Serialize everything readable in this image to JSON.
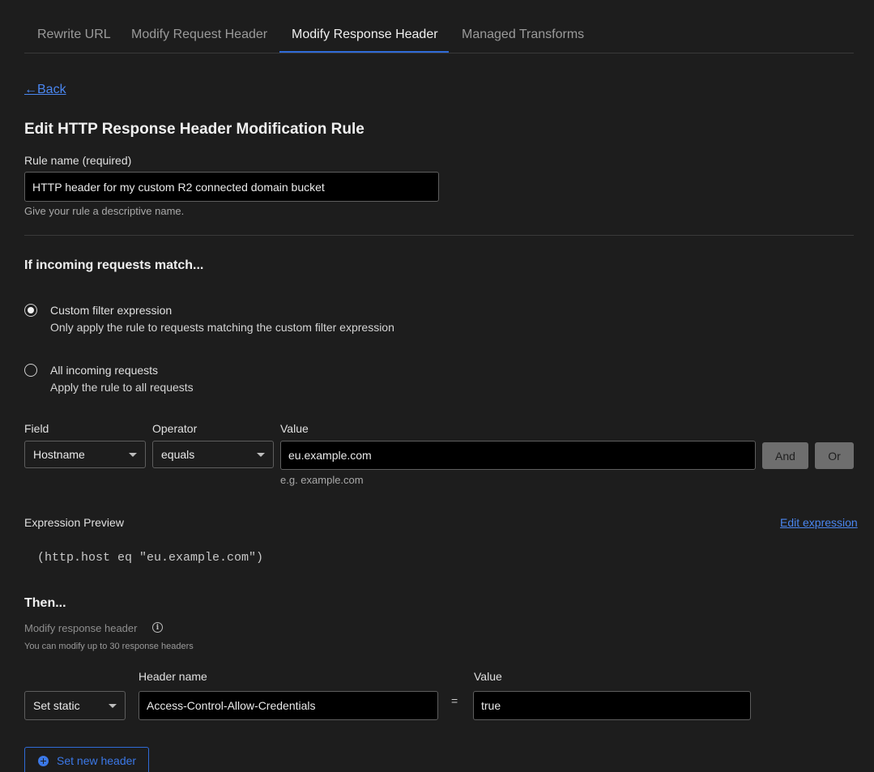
{
  "tabs": [
    {
      "label": "Rewrite URL"
    },
    {
      "label": "Modify Request Header"
    },
    {
      "label": "Modify Response Header"
    },
    {
      "label": "Managed Transforms"
    }
  ],
  "active_tab": "Modify Response Header",
  "back_link": {
    "arrow": "←",
    "label": "Back"
  },
  "page_title": "Edit HTTP Response Header Modification Rule",
  "rule_name": {
    "label": "Rule name (required)",
    "value": "HTTP header for my custom R2 connected domain bucket",
    "help": "Give your rule a descriptive name."
  },
  "match": {
    "heading": "If incoming requests match...",
    "options": [
      {
        "title": "Custom filter expression",
        "description": "Only apply the rule to requests matching the custom filter expression",
        "selected": true
      },
      {
        "title": "All incoming requests",
        "description": "Apply the rule to all requests",
        "selected": false
      }
    ]
  },
  "filter": {
    "field_label": "Field",
    "operator_label": "Operator",
    "value_label": "Value",
    "field_value": "Hostname",
    "operator_value": "equals",
    "value_value": "eu.example.com",
    "value_hint": "e.g. example.com",
    "and_label": "And",
    "or_label": "Or"
  },
  "expression": {
    "label": "Expression Preview",
    "edit_link": "Edit expression",
    "code": "(http.host eq \"eu.example.com\")"
  },
  "then": {
    "heading": "Then...",
    "subheading": "Modify response header",
    "info_icon": "info-icon",
    "limit_hint": "You can modify up to 30 response headers",
    "header_name_label": "Header name",
    "value_label": "Value",
    "action_value": "Set static",
    "header_name_value": "Access-Control-Allow-Credentials",
    "equals_sign": "=",
    "header_value": "true",
    "add_button": "Set new header"
  },
  "colors": {
    "background": "#1d1d1d",
    "accent": "#2f6bd8",
    "link": "#4a86f0",
    "input_bg": "#000000"
  }
}
